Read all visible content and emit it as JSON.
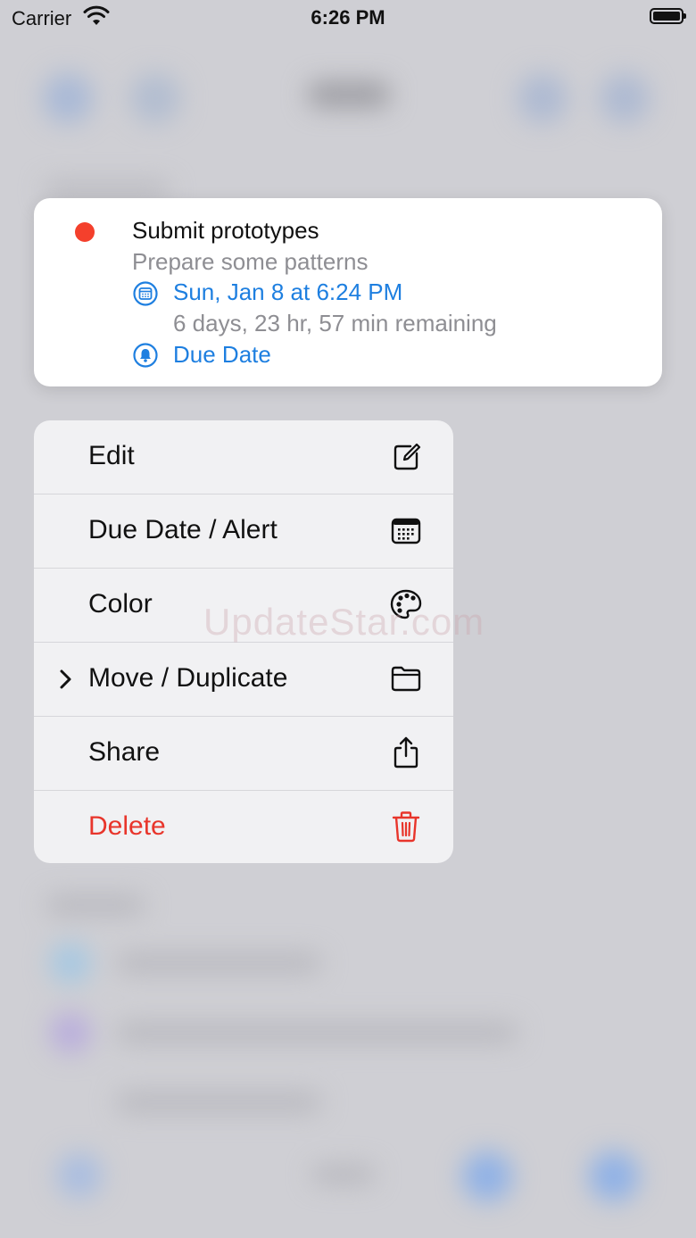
{
  "status_bar": {
    "carrier": "Carrier",
    "time": "6:26 PM"
  },
  "task": {
    "title": "Submit prototypes",
    "notes": "Prepare some patterns",
    "due_date": "Sun, Jan 8 at 6:24 PM",
    "remaining": "6 days, 23 hr, 57 min remaining",
    "alert": "Due Date",
    "color": "#f4402c"
  },
  "menu": {
    "items": [
      {
        "label": "Edit",
        "icon": "edit-icon"
      },
      {
        "label": "Due Date / Alert",
        "icon": "calendar-icon"
      },
      {
        "label": "Color",
        "icon": "palette-icon"
      },
      {
        "label": "Move / Duplicate",
        "icon": "folder-icon"
      },
      {
        "label": "Share",
        "icon": "share-icon"
      },
      {
        "label": "Delete",
        "icon": "trash-icon"
      }
    ]
  },
  "watermark": "UpdateStar.com",
  "colors": {
    "accent": "#1e7fe0",
    "danger": "#e8352b"
  }
}
